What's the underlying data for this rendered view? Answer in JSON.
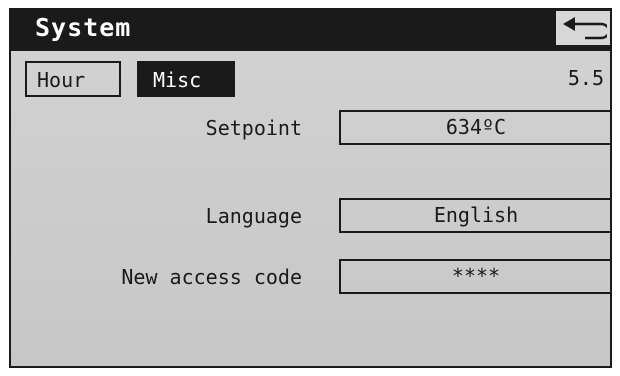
{
  "header": {
    "title": "System",
    "back_icon": "back-arrow-icon"
  },
  "tabs": [
    {
      "label": "Hour",
      "active": false
    },
    {
      "label": "Misc",
      "active": true
    }
  ],
  "version": "5.5",
  "settings": {
    "setpoint": {
      "label": "Setpoint",
      "value": "634ºC"
    },
    "language": {
      "label": "Language",
      "value": "English"
    },
    "access_code": {
      "label": "New access code",
      "value": "****"
    }
  },
  "colors": {
    "header_bg": "#1b1a1a",
    "screen_bg": "#cbcccb",
    "active_tab_bg": "#1b1a1a",
    "text": "#1a1a1a"
  }
}
